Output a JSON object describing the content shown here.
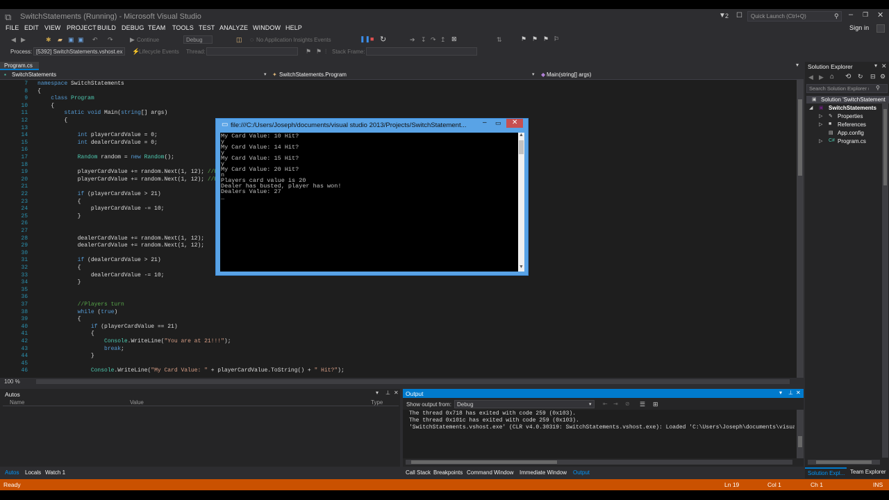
{
  "window": {
    "title": "SwitchStatements (Running) - Microsoft Visual Studio",
    "notif_count": "2",
    "quick_launch": "Quick Launch (Ctrl+Q)",
    "signin": "Sign in"
  },
  "menu": [
    "FILE",
    "EDIT",
    "VIEW",
    "PROJECT",
    "BUILD",
    "DEBUG",
    "TEAM",
    "TOOLS",
    "TEST",
    "ANALYZE",
    "WINDOW",
    "HELP"
  ],
  "toolbar": {
    "continue": "Continue",
    "config": "Debug",
    "insights": "No Application Insights Events"
  },
  "debugbar": {
    "process_label": "Process:",
    "process": "[5392] SwitchStatements.vshost.ex",
    "lifecycle": "Lifecycle Events",
    "thread": "Thread:",
    "stackframe": "Stack Frame:"
  },
  "editor": {
    "tab": "Program.cs",
    "nav_project": "SwitchStatements",
    "nav_class": "SwitchStatements.Program",
    "nav_member": "Main(string[] args)",
    "zoom": "100 %",
    "lines": [
      {
        "n": "7",
        "t": "namespace SwitchStatements"
      },
      {
        "n": "8",
        "t": "{"
      },
      {
        "n": "9",
        "t": "    class Program"
      },
      {
        "n": "10",
        "t": "    {"
      },
      {
        "n": "11",
        "t": "        static void Main(string[] args)"
      },
      {
        "n": "12",
        "t": "        {"
      },
      {
        "n": "13",
        "t": ""
      },
      {
        "n": "14",
        "t": "            int playerCardValue = 0;"
      },
      {
        "n": "15",
        "t": "            int dealerCardValue = 0;"
      },
      {
        "n": "16",
        "t": ""
      },
      {
        "n": "17",
        "t": "            Random random = new Random();"
      },
      {
        "n": "18",
        "t": ""
      },
      {
        "n": "19",
        "t": "            playerCardValue += random.Next(1, 12); //Ra"
      },
      {
        "n": "20",
        "t": "            playerCardValue += random.Next(1, 12); //Ra"
      },
      {
        "n": "21",
        "t": ""
      },
      {
        "n": "22",
        "t": "            if (playerCardValue > 21)"
      },
      {
        "n": "23",
        "t": "            {"
      },
      {
        "n": "24",
        "t": "                playerCardValue -= 10;"
      },
      {
        "n": "25",
        "t": "            }"
      },
      {
        "n": "26",
        "t": ""
      },
      {
        "n": "27",
        "t": ""
      },
      {
        "n": "28",
        "t": "            dealerCardValue += random.Next(1, 12);"
      },
      {
        "n": "29",
        "t": "            dealerCardValue += random.Next(1, 12);"
      },
      {
        "n": "30",
        "t": ""
      },
      {
        "n": "31",
        "t": "            if (dealerCardValue > 21)"
      },
      {
        "n": "32",
        "t": "            {"
      },
      {
        "n": "33",
        "t": "                dealerCardValue -= 10;"
      },
      {
        "n": "34",
        "t": "            }"
      },
      {
        "n": "35",
        "t": ""
      },
      {
        "n": "36",
        "t": ""
      },
      {
        "n": "37",
        "t": "            //Players turn"
      },
      {
        "n": "38",
        "t": "            while (true)"
      },
      {
        "n": "39",
        "t": "            {"
      },
      {
        "n": "40",
        "t": "                if (playerCardValue == 21)"
      },
      {
        "n": "41",
        "t": "                {"
      },
      {
        "n": "42",
        "t": "                    Console.WriteLine(\"You are at 21!!!\");"
      },
      {
        "n": "43",
        "t": "                    break;"
      },
      {
        "n": "44",
        "t": "                }"
      },
      {
        "n": "45",
        "t": ""
      },
      {
        "n": "46",
        "t": "                Console.WriteLine(\"My Card Value: \" + playerCardValue.ToString() + \" Hit?\");"
      }
    ]
  },
  "console": {
    "title": "file:///C:/Users/Joseph/documents/visual studio 2013/Projects/SwitchStatement...",
    "lines": [
      "My Card Value: 10 Hit?",
      "y",
      "My Card Value: 14 Hit?",
      "y",
      "My Card Value: 15 Hit?",
      "y",
      "My Card Value: 20 Hit?",
      "n",
      "Players card value is 20",
      "Dealer has busted, player has won!",
      "Dealers Value: 27",
      "_"
    ]
  },
  "solution": {
    "title": "Solution Explorer",
    "search": "Search Solution Explorer (",
    "root": "Solution 'SwitchStatement",
    "project": "SwitchStatements",
    "items": [
      "Properties",
      "References",
      "App.config",
      "Program.cs"
    ]
  },
  "autos": {
    "title": "Autos",
    "col_name": "Name",
    "col_value": "Value",
    "col_type": "Type",
    "tabs": [
      "Autos",
      "Locals",
      "Watch 1"
    ]
  },
  "output": {
    "title": "Output",
    "show_from": "Show output from:",
    "source": "Debug",
    "lines": [
      "The thread 0x718 has exited with code 259 (0x103).",
      "The thread 0x101c has exited with code 259 (0x103).",
      "'SwitchStatements.vshost.exe' (CLR v4.0.30319: SwitchStatements.vshost.exe): Loaded 'C:\\Users\\Joseph\\documents\\visual s"
    ],
    "tabs": [
      "Call Stack",
      "Breakpoints",
      "Command Window",
      "Immediate Window",
      "Output"
    ]
  },
  "bottom_right_tabs": [
    "Solution Expl...",
    "Team Explorer"
  ],
  "status": {
    "state": "Ready",
    "ln": "Ln 19",
    "col": "Col 1",
    "ch": "Ch 1",
    "mode": "INS"
  },
  "colors": {
    "accent": "#007acc",
    "status": "#ca5100"
  }
}
